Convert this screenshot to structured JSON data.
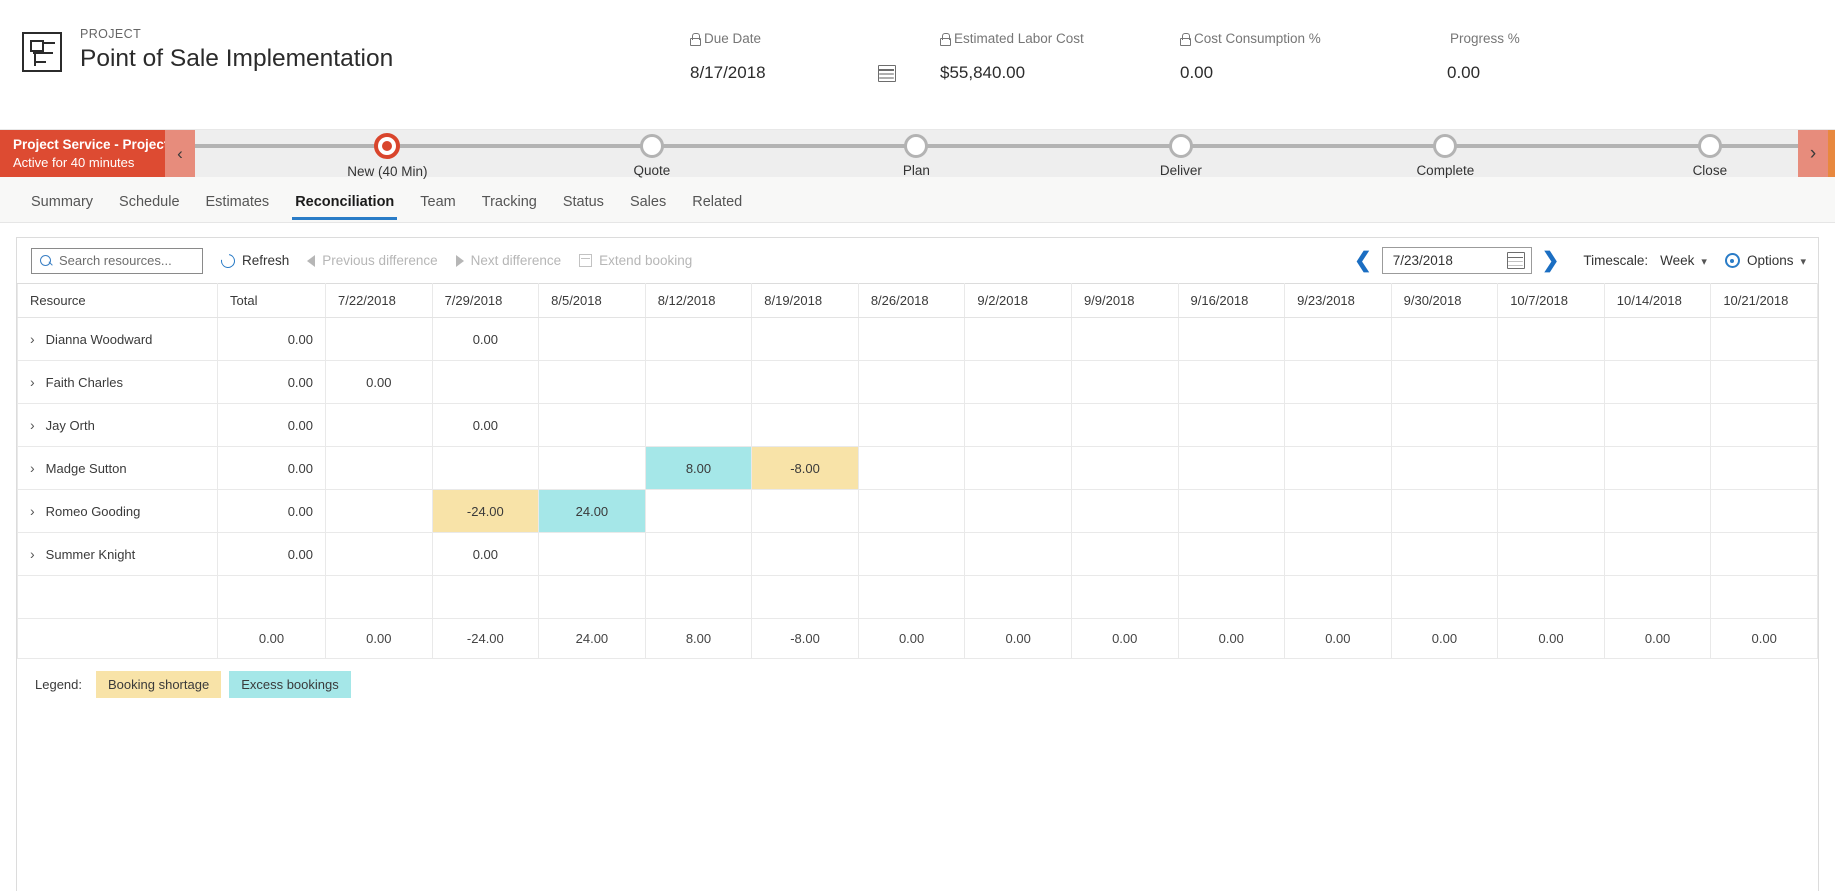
{
  "header": {
    "eyebrow": "PROJECT",
    "title": "Point of Sale Implementation",
    "icon": "project-icon",
    "metrics": [
      {
        "label": "Due Date",
        "value": "8/17/2018",
        "locked": true,
        "icon": "lock-icon",
        "trailing_icon": "calendar-icon"
      },
      {
        "label": "Estimated Labor Cost",
        "value": "$55,840.00",
        "locked": true,
        "icon": "lock-icon"
      },
      {
        "label": "Cost Consumption %",
        "value": "0.00",
        "locked": true,
        "icon": "lock-icon"
      },
      {
        "label": "Progress %",
        "value": "0.00",
        "locked": false
      }
    ]
  },
  "process_flow": {
    "name": "Project Service - Project ...",
    "status": "Active for 40 minutes",
    "collapse_icon": "chevron-left-icon",
    "next_icon": "chevron-right-icon",
    "active_color": "#d9452c",
    "stages": [
      {
        "label": "New  (40 Min)",
        "active": true
      },
      {
        "label": "Quote",
        "active": false
      },
      {
        "label": "Plan",
        "active": false
      },
      {
        "label": "Deliver",
        "active": false
      },
      {
        "label": "Complete",
        "active": false
      },
      {
        "label": "Close",
        "active": false
      }
    ]
  },
  "tabs": [
    {
      "label": "Summary",
      "active": false
    },
    {
      "label": "Schedule",
      "active": false
    },
    {
      "label": "Estimates",
      "active": false
    },
    {
      "label": "Reconciliation",
      "active": true
    },
    {
      "label": "Team",
      "active": false
    },
    {
      "label": "Tracking",
      "active": false
    },
    {
      "label": "Status",
      "active": false
    },
    {
      "label": "Sales",
      "active": false
    },
    {
      "label": "Related",
      "active": false
    }
  ],
  "toolbar": {
    "search_placeholder": "Search resources...",
    "search_value": "",
    "refresh_label": "Refresh",
    "previous_difference_label": "Previous difference",
    "next_difference_label": "Next difference",
    "extend_booking_label": "Extend booking",
    "date_value": "7/23/2018",
    "prev_icon": "chevron-left-icon",
    "next_icon": "chevron-right-icon",
    "calendar_icon": "calendar-icon",
    "timescale_label": "Timescale:",
    "timescale_value": "Week",
    "options_label": "Options",
    "gear_icon": "gear-icon"
  },
  "grid": {
    "columns": [
      "Resource",
      "Total",
      "7/22/2018",
      "7/29/2018",
      "8/5/2018",
      "8/12/2018",
      "8/19/2018",
      "8/26/2018",
      "9/2/2018",
      "9/9/2018",
      "9/16/2018",
      "9/23/2018",
      "9/30/2018",
      "10/7/2018",
      "10/14/2018",
      "10/21/2018"
    ],
    "rows": [
      {
        "resource": "Dianna Woodward",
        "total": "0.00",
        "cells": [
          {
            "v": "",
            "s": ""
          },
          {
            "v": "0.00",
            "s": ""
          },
          {
            "v": "",
            "s": ""
          },
          {
            "v": "",
            "s": ""
          },
          {
            "v": "",
            "s": ""
          },
          {
            "v": "",
            "s": ""
          },
          {
            "v": "",
            "s": ""
          },
          {
            "v": "",
            "s": ""
          },
          {
            "v": "",
            "s": ""
          },
          {
            "v": "",
            "s": ""
          },
          {
            "v": "",
            "s": ""
          },
          {
            "v": "",
            "s": ""
          },
          {
            "v": "",
            "s": ""
          },
          {
            "v": "",
            "s": ""
          }
        ]
      },
      {
        "resource": "Faith Charles",
        "total": "0.00",
        "cells": [
          {
            "v": "0.00",
            "s": ""
          },
          {
            "v": "",
            "s": ""
          },
          {
            "v": "",
            "s": ""
          },
          {
            "v": "",
            "s": ""
          },
          {
            "v": "",
            "s": ""
          },
          {
            "v": "",
            "s": ""
          },
          {
            "v": "",
            "s": ""
          },
          {
            "v": "",
            "s": ""
          },
          {
            "v": "",
            "s": ""
          },
          {
            "v": "",
            "s": ""
          },
          {
            "v": "",
            "s": ""
          },
          {
            "v": "",
            "s": ""
          },
          {
            "v": "",
            "s": ""
          },
          {
            "v": "",
            "s": ""
          }
        ]
      },
      {
        "resource": "Jay Orth",
        "total": "0.00",
        "cells": [
          {
            "v": "",
            "s": ""
          },
          {
            "v": "0.00",
            "s": ""
          },
          {
            "v": "",
            "s": ""
          },
          {
            "v": "",
            "s": ""
          },
          {
            "v": "",
            "s": ""
          },
          {
            "v": "",
            "s": ""
          },
          {
            "v": "",
            "s": ""
          },
          {
            "v": "",
            "s": ""
          },
          {
            "v": "",
            "s": ""
          },
          {
            "v": "",
            "s": ""
          },
          {
            "v": "",
            "s": ""
          },
          {
            "v": "",
            "s": ""
          },
          {
            "v": "",
            "s": ""
          },
          {
            "v": "",
            "s": ""
          }
        ]
      },
      {
        "resource": "Madge Sutton",
        "total": "0.00",
        "cells": [
          {
            "v": "",
            "s": ""
          },
          {
            "v": "",
            "s": ""
          },
          {
            "v": "",
            "s": ""
          },
          {
            "v": "8.00",
            "s": "excess"
          },
          {
            "v": "-8.00",
            "s": "shortage"
          },
          {
            "v": "",
            "s": ""
          },
          {
            "v": "",
            "s": ""
          },
          {
            "v": "",
            "s": ""
          },
          {
            "v": "",
            "s": ""
          },
          {
            "v": "",
            "s": ""
          },
          {
            "v": "",
            "s": ""
          },
          {
            "v": "",
            "s": ""
          },
          {
            "v": "",
            "s": ""
          },
          {
            "v": "",
            "s": ""
          }
        ]
      },
      {
        "resource": "Romeo Gooding",
        "total": "0.00",
        "cells": [
          {
            "v": "",
            "s": ""
          },
          {
            "v": "-24.00",
            "s": "shortage"
          },
          {
            "v": "24.00",
            "s": "excess"
          },
          {
            "v": "",
            "s": ""
          },
          {
            "v": "",
            "s": ""
          },
          {
            "v": "",
            "s": ""
          },
          {
            "v": "",
            "s": ""
          },
          {
            "v": "",
            "s": ""
          },
          {
            "v": "",
            "s": ""
          },
          {
            "v": "",
            "s": ""
          },
          {
            "v": "",
            "s": ""
          },
          {
            "v": "",
            "s": ""
          },
          {
            "v": "",
            "s": ""
          },
          {
            "v": "",
            "s": ""
          }
        ]
      },
      {
        "resource": "Summer Knight",
        "total": "0.00",
        "cells": [
          {
            "v": "",
            "s": ""
          },
          {
            "v": "0.00",
            "s": ""
          },
          {
            "v": "",
            "s": ""
          },
          {
            "v": "",
            "s": ""
          },
          {
            "v": "",
            "s": ""
          },
          {
            "v": "",
            "s": ""
          },
          {
            "v": "",
            "s": ""
          },
          {
            "v": "",
            "s": ""
          },
          {
            "v": "",
            "s": ""
          },
          {
            "v": "",
            "s": ""
          },
          {
            "v": "",
            "s": ""
          },
          {
            "v": "",
            "s": ""
          },
          {
            "v": "",
            "s": ""
          },
          {
            "v": "",
            "s": ""
          }
        ]
      }
    ],
    "totals": {
      "resource": "",
      "total": "0.00",
      "cells": [
        "0.00",
        "-24.00",
        "24.00",
        "8.00",
        "-8.00",
        "0.00",
        "0.00",
        "0.00",
        "0.00",
        "0.00",
        "0.00",
        "0.00",
        "0.00",
        "0.00"
      ]
    },
    "expand_icon": "chevron-right-icon"
  },
  "legend": {
    "label": "Legend:",
    "items": [
      {
        "text": "Booking shortage",
        "color": "#f8e3a8",
        "style": "shortage"
      },
      {
        "text": "Excess bookings",
        "color": "#a5e7e8",
        "style": "excess"
      }
    ]
  }
}
